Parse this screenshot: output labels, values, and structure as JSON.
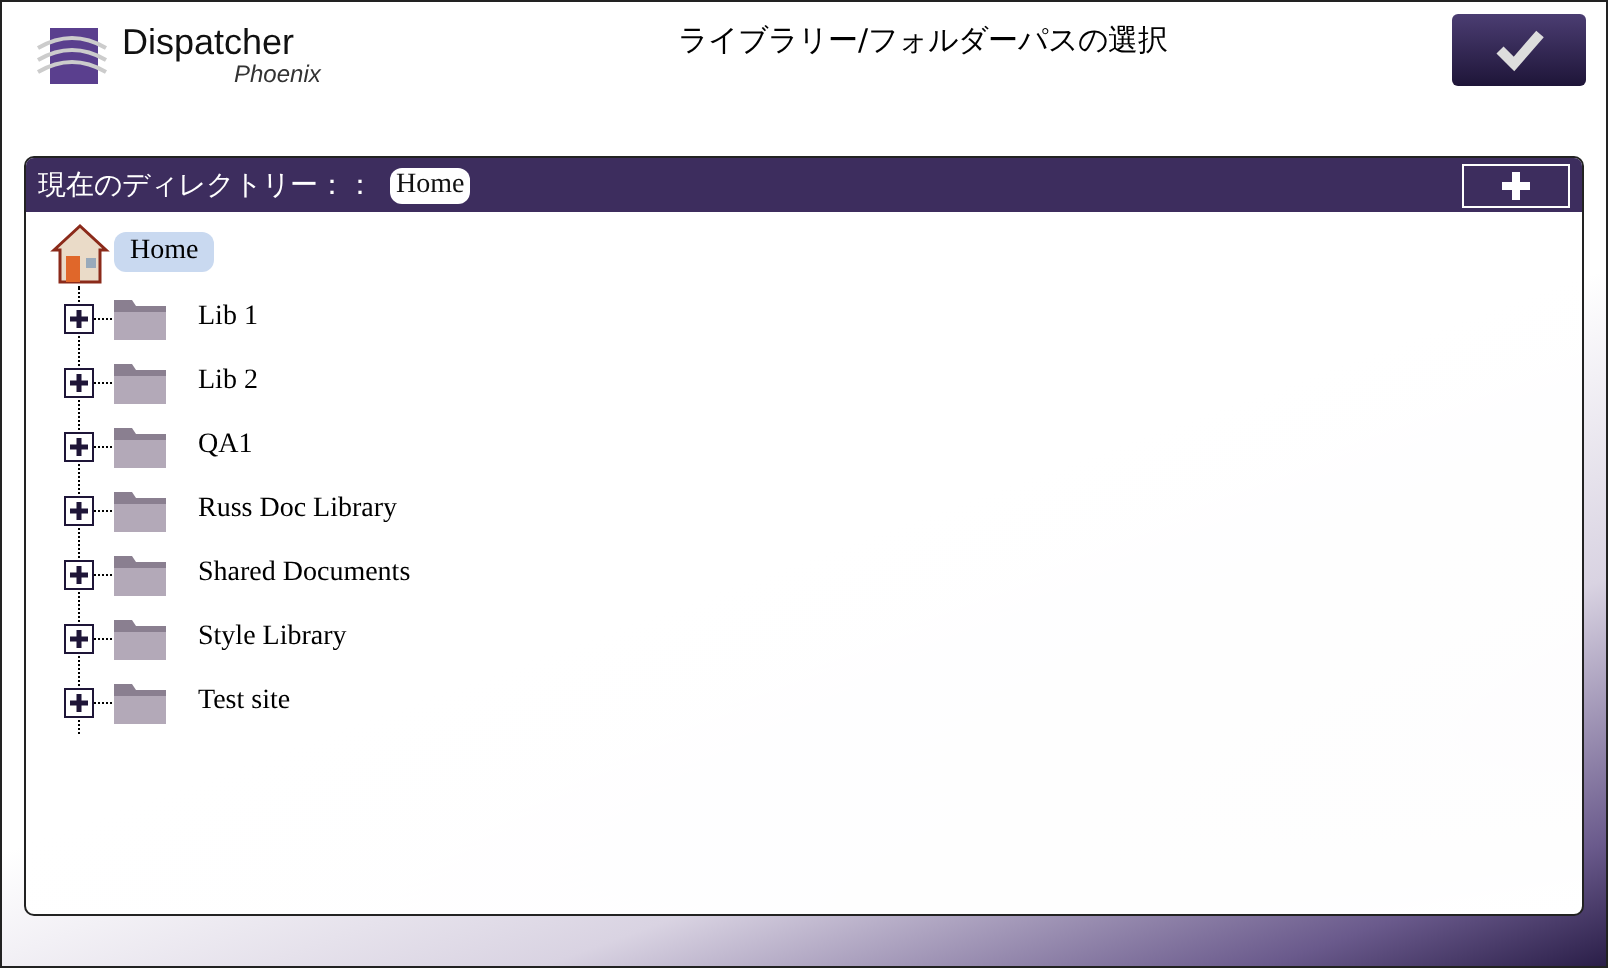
{
  "logo": {
    "name": "Dispatcher",
    "subtitle": "Phoenix"
  },
  "window": {
    "title": "ライブラリー/フォルダーパスの選択"
  },
  "directory_bar": {
    "label": "現在のディレクトリー：：",
    "current": "Home"
  },
  "tree": {
    "label": "Home",
    "selected": true,
    "children": [
      {
        "label": "Lib 1",
        "expanded": false,
        "selected": false
      },
      {
        "label": "Lib 2",
        "expanded": false,
        "selected": false
      },
      {
        "label": "QA1",
        "expanded": false,
        "selected": false
      },
      {
        "label": "Russ Doc Library",
        "expanded": false,
        "selected": false
      },
      {
        "label": "Shared Documents",
        "expanded": false,
        "selected": false
      },
      {
        "label": "Style Library",
        "expanded": false,
        "selected": false
      },
      {
        "label": "Test site",
        "expanded": false,
        "selected": false
      }
    ]
  }
}
